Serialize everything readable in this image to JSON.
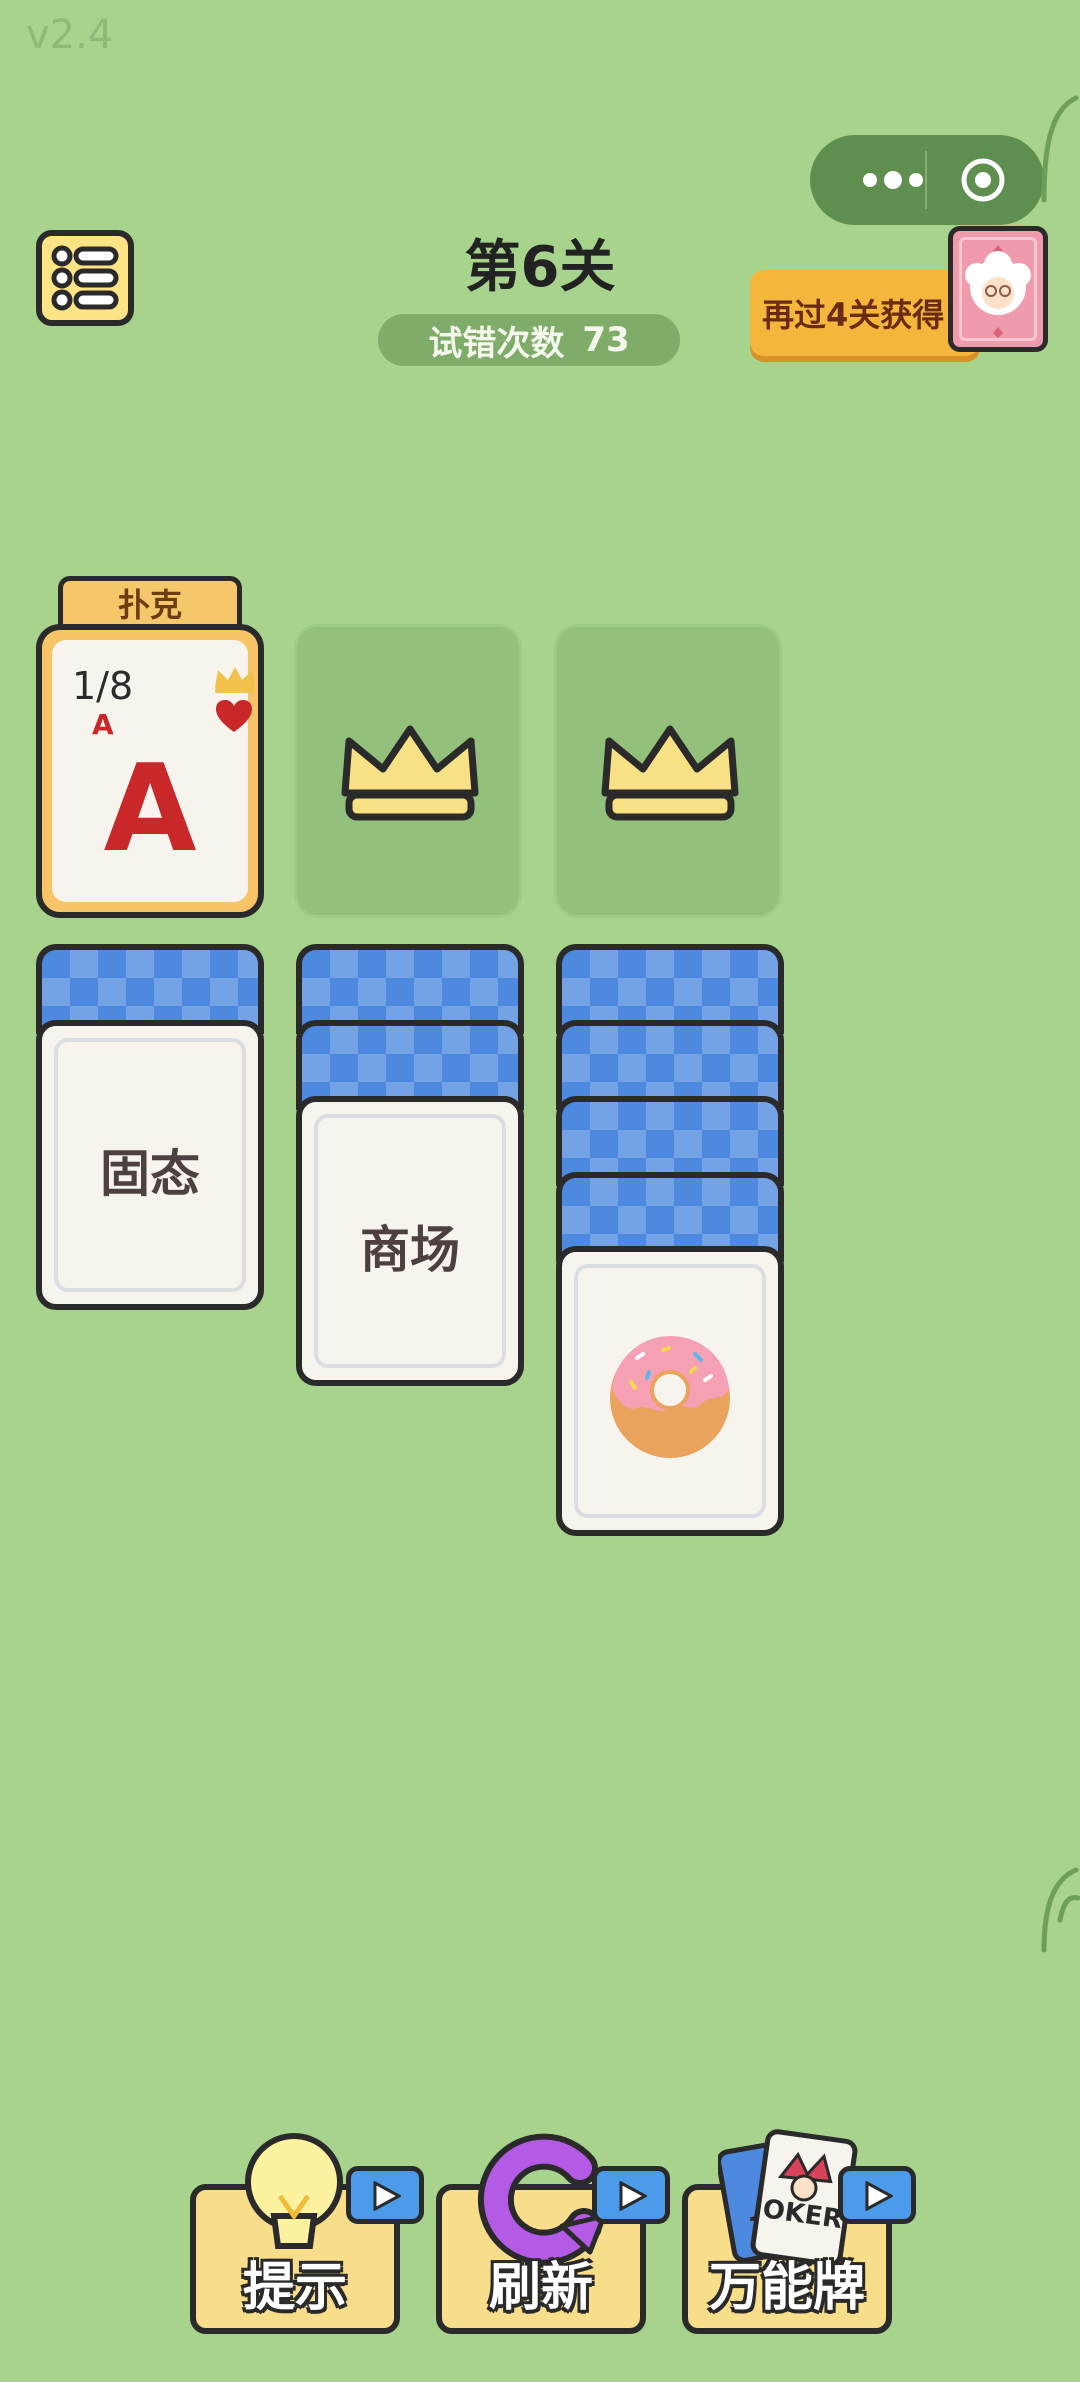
{
  "version": "v2.4",
  "header": {
    "level_title": "第6关",
    "tries_label": "试错次数",
    "tries_value": "73",
    "reward_text": "再过4关获得"
  },
  "foundation": {
    "tab_label": "扑克",
    "progress": "1/8",
    "rank": "A",
    "suit": "heart"
  },
  "columns": [
    {
      "hidden_cards": 1,
      "face": "固态"
    },
    {
      "hidden_cards": 2,
      "face": "商场"
    },
    {
      "hidden_cards": 4,
      "face": "donut-icon"
    }
  ],
  "tools": [
    {
      "label": "提示",
      "icon": "lightbulb-icon"
    },
    {
      "label": "刷新",
      "icon": "refresh-icon"
    },
    {
      "label": "万能牌",
      "icon": "joker-card-icon",
      "card_text": "JOKER"
    }
  ],
  "colors": {
    "background": "#a8d38c",
    "card_back": "#4d89de",
    "accent_yellow": "#f7c468",
    "ace_red": "#c8282a"
  }
}
